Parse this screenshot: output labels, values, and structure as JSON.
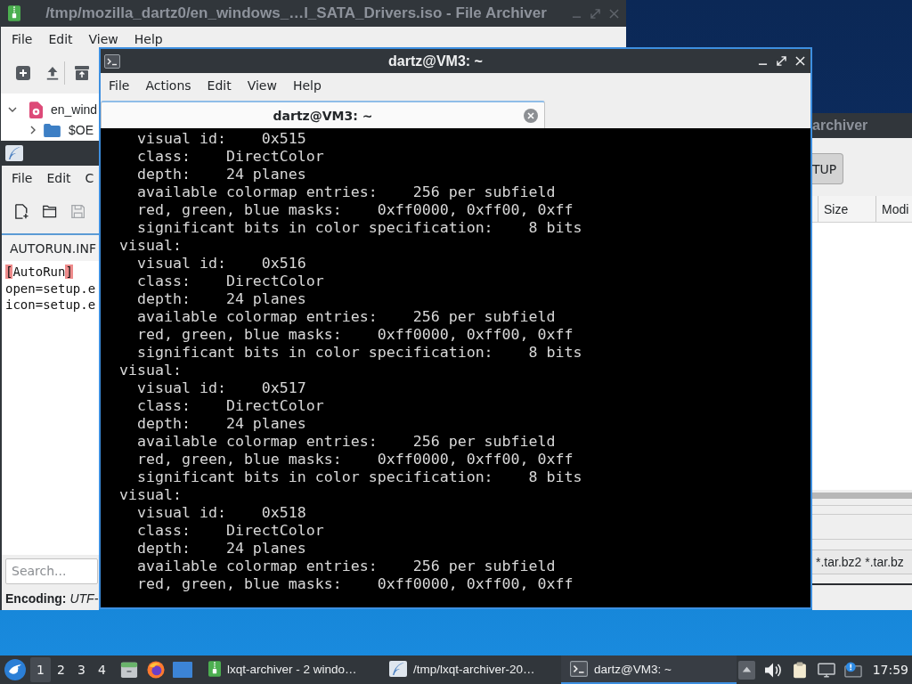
{
  "archive_window": {
    "title": "/tmp/mozilla_dartz0/en_windows_…l_SATA_Drivers.iso - File Archiver",
    "active": false,
    "menu": [
      "File",
      "Edit",
      "View",
      "Help"
    ],
    "tree": [
      {
        "label": "en_wind",
        "expanded": true,
        "children": [
          {
            "label": "$OE",
            "expanded": false
          }
        ]
      }
    ]
  },
  "editor_window": {
    "menu": [
      "File",
      "Edit",
      "C"
    ],
    "toolbar": [
      {
        "kind": "new",
        "disabled": false
      },
      {
        "kind": "open",
        "disabled": false
      },
      {
        "kind": "save",
        "disabled": true
      }
    ],
    "tabs": [
      {
        "label": "AUTORUN.INF",
        "selected": true
      }
    ],
    "lines": [
      [
        {
          "text": "[",
          "highlight": true
        },
        {
          "text": "AutoRun",
          "highlight": false
        },
        {
          "text": "]",
          "highlight": true
        }
      ],
      [
        {
          "text": "open=setup.e",
          "highlight": false
        }
      ],
      [
        {
          "text": "icon=setup.e",
          "highlight": false
        }
      ]
    ],
    "search": {
      "placeholder": "Search..."
    },
    "status": {
      "label": "Encoding:",
      "value": "UTF-"
    }
  },
  "archive_window_2": {
    "title": "archiver",
    "active": false,
    "path_buttons": [
      {
        "label": "TUP",
        "selected": true
      }
    ],
    "columns": [
      "Size",
      "Modi"
    ],
    "filter": "*.tar.bz2 *.tar.bz"
  },
  "terminal_window": {
    "title": "dartz@VM3: ~",
    "active": true,
    "menu": [
      "File",
      "Actions",
      "Edit",
      "View",
      "Help"
    ],
    "tabs": [
      {
        "label": "dartz@VM3: ~",
        "selected": true
      }
    ],
    "output": [
      {
        "children": [
          "visual id:    0x515",
          "class:    DirectColor",
          "depth:    24 planes",
          "available colormap entries:    256 per subfield",
          "red, green, blue masks:    0xff0000, 0xff00, 0xff",
          "significant bits in color specification:    8 bits"
        ]
      },
      {
        "text": "visual:",
        "children": [
          "visual id:    0x516",
          "class:    DirectColor",
          "depth:    24 planes",
          "available colormap entries:    256 per subfield",
          "red, green, blue masks:    0xff0000, 0xff00, 0xff",
          "significant bits in color specification:    8 bits"
        ]
      },
      {
        "text": "visual:",
        "children": [
          "visual id:    0x517",
          "class:    DirectColor",
          "depth:    24 planes",
          "available colormap entries:    256 per subfield",
          "red, green, blue masks:    0xff0000, 0xff00, 0xff",
          "significant bits in color specification:    8 bits"
        ]
      },
      {
        "text": "visual:",
        "children": [
          "visual id:    0x518",
          "class:    DirectColor",
          "depth:    24 planes",
          "available colormap entries:    256 per subfield",
          "red, green, blue masks:    0xff0000, 0xff00, 0xff"
        ]
      }
    ]
  },
  "taskbar": {
    "desktops": [
      {
        "label": "1",
        "selected": true
      },
      {
        "label": "2",
        "selected": false
      },
      {
        "label": "3",
        "selected": false
      },
      {
        "label": "4",
        "selected": false
      }
    ],
    "tasks": [
      {
        "kind": "archiver",
        "label": "lxqt-archiver - 2 windo…",
        "selected": false
      },
      {
        "kind": "editor",
        "label": "/tmp/lxqt-archiver-20…",
        "selected": false
      },
      {
        "kind": "terminal",
        "label": "dartz@VM3: ~",
        "selected": true
      }
    ],
    "clock": "17:59"
  }
}
